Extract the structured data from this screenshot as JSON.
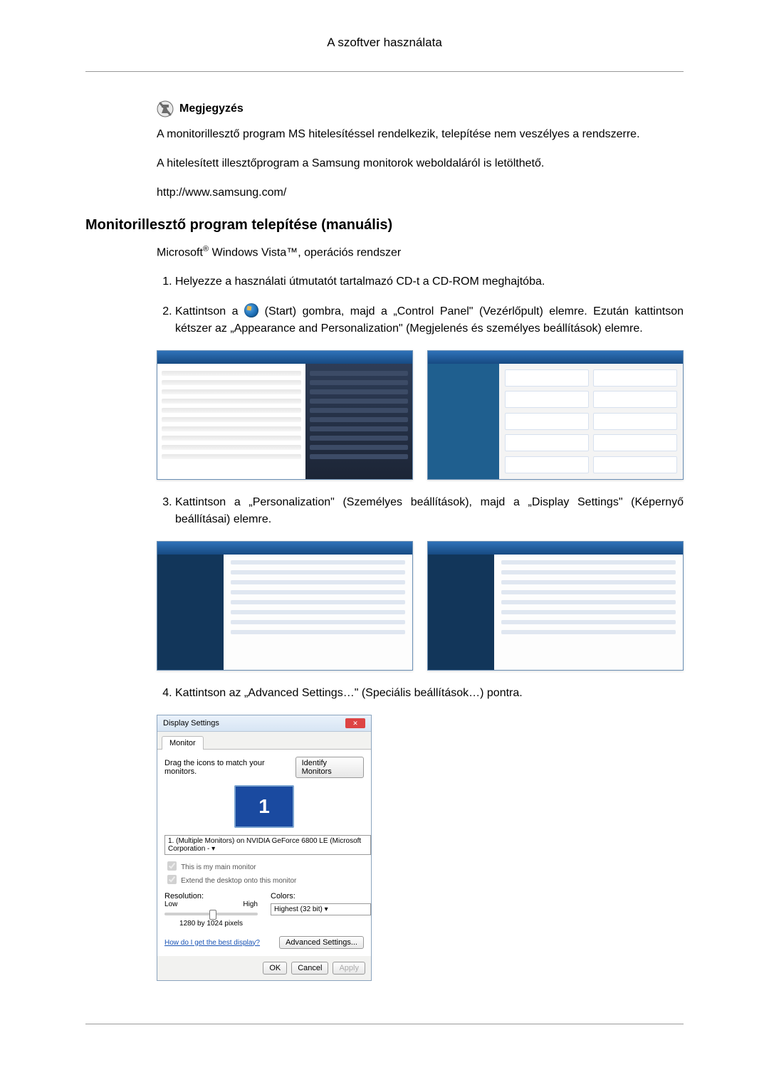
{
  "page": {
    "header_title": "A szoftver használata"
  },
  "note": {
    "label": "Megjegyzés",
    "p1": "A monitorillesztő program MS hitelesítéssel rendelkezik, telepítése nem veszélyes a rendszerre.",
    "p2": "A hitelesített illesztőprogram a Samsung monitorok weboldaláról is letölthető.",
    "url": "http://www.samsung.com/"
  },
  "section": {
    "title": "Monitorillesztő program telepítése (manuális)",
    "intro_prefix": "Microsoft",
    "intro_reg": "®",
    "intro_mid": " Windows Vista™, operációs rendszer"
  },
  "steps": {
    "s1": "Helyezze a használati útmutatót tartalmazó CD-t a CD-ROM meghajtóba.",
    "s2_a": "Kattintson a ",
    "s2_b": "(Start) gombra, majd a „Control Panel\" (Vezérlőpult) elemre. Ezután kattintson kétszer az „Appearance and Personalization\" (Megjelenés és személyes beállítások) elemre.",
    "s3": "Kattintson a „Personalization\" (Személyes beállítások), majd a „Display Settings\" (Képernyő beállításai) elemre.",
    "s4": "Kattintson az „Advanced Settings…\" (Speciális beállítások…) pontra."
  },
  "dialog": {
    "title": "Display Settings",
    "tab": "Monitor",
    "drag_text": "Drag the icons to match your monitors.",
    "identify_btn": "Identify Monitors",
    "monitor_number": "1",
    "monitor_select": "1. (Multiple Monitors) on NVIDIA GeForce 6800 LE (Microsoft Corporation - ▾",
    "chk_main": "This is my main monitor",
    "chk_extend": "Extend the desktop onto this monitor",
    "resolution_label": "Resolution:",
    "res_low": "Low",
    "res_high": "High",
    "res_value": "1280 by 1024 pixels",
    "colors_label": "Colors:",
    "colors_value": "Highest (32 bit)    ▾",
    "help_link": "How do I get the best display?",
    "adv_btn": "Advanced Settings...",
    "ok": "OK",
    "cancel": "Cancel",
    "apply": "Apply"
  }
}
